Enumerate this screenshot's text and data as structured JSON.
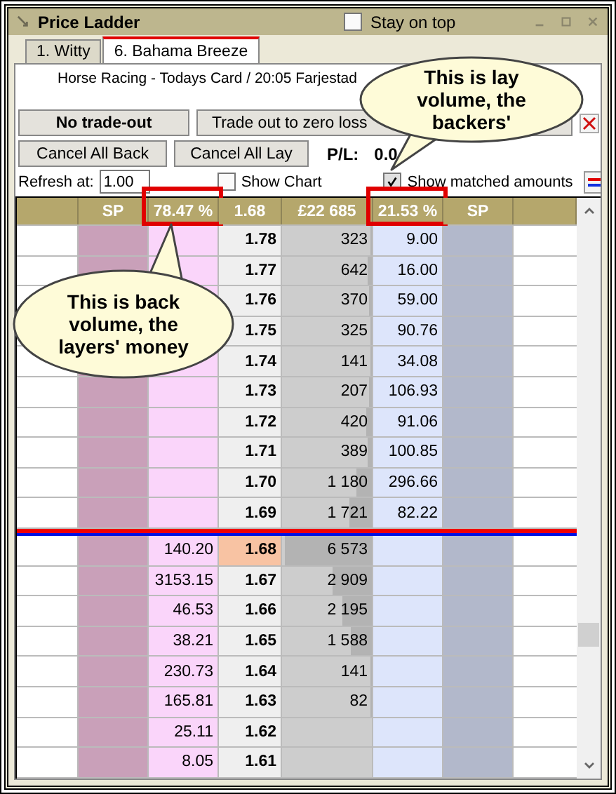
{
  "window": {
    "title": "Price Ladder",
    "stay_on_top": {
      "label": "Stay on top",
      "checked": false
    }
  },
  "tabs": [
    {
      "label": "1. Witty",
      "selected": false
    },
    {
      "label": "6. Bahama Breeze",
      "selected": true
    }
  ],
  "market": "Horse Racing - Todays Card / 20:05 Farjestad",
  "buttons": {
    "no_trade": "No trade-out",
    "trade_out": "Trade out to zero loss",
    "cancel_back": "Cancel All Back",
    "cancel_lay": "Cancel All Lay"
  },
  "pl": {
    "label": "P/L:",
    "value": "0.0"
  },
  "refresh": {
    "label": "Refresh at:",
    "value": "1.00"
  },
  "options": [
    {
      "label": "Show Chart",
      "checked": false
    },
    {
      "label": "Show matched amounts",
      "checked": true
    }
  ],
  "header": [
    {
      "label": "SP",
      "highlighted": false
    },
    {
      "label": "78.47 %",
      "highlighted": true
    },
    {
      "label": "1.68",
      "highlighted": false
    },
    {
      "label": "£22 685",
      "highlighted": false
    },
    {
      "label": "21.53 %",
      "highlighted": true
    },
    {
      "label": "SP",
      "highlighted": false
    }
  ],
  "upper_rows": [
    {
      "price": "1.78",
      "volume": "323",
      "level": 0.02,
      "lay": "9.00"
    },
    {
      "price": "1.77",
      "volume": "642",
      "level": 0.05,
      "lay": "16.00"
    },
    {
      "price": "1.76",
      "volume": "370",
      "level": 0.03,
      "lay": "59.00"
    },
    {
      "price": "1.75",
      "volume": "325",
      "level": 0.02,
      "lay": "90.76"
    },
    {
      "price": "1.74",
      "volume": "141",
      "level": 0.02,
      "lay": "34.08"
    },
    {
      "price": "1.73",
      "volume": "207",
      "level": 0.03,
      "lay": "106.93"
    },
    {
      "price": "1.72",
      "volume": "420",
      "level": 0.06,
      "lay": "91.06"
    },
    {
      "price": "1.71",
      "volume": "389",
      "level": 0.04,
      "lay": "100.85"
    },
    {
      "price": "1.70",
      "volume": "1 180",
      "level": 0.17,
      "lay": "296.66"
    },
    {
      "price": "1.69",
      "volume": "1 721",
      "level": 0.25,
      "lay": "82.22"
    }
  ],
  "lower_rows": [
    {
      "back": "140.20",
      "price": "1.68",
      "current": true,
      "volume": "6 573",
      "level": 0.97
    },
    {
      "back": "3153.15",
      "price": "1.67",
      "current": false,
      "volume": "2 909",
      "level": 0.44
    },
    {
      "back": "46.53",
      "price": "1.66",
      "current": false,
      "volume": "2 195",
      "level": 0.33
    },
    {
      "back": "38.21",
      "price": "1.65",
      "current": false,
      "volume": "1 588",
      "level": 0.24
    },
    {
      "back": "230.73",
      "price": "1.64",
      "current": false,
      "volume": "141",
      "level": 0.02
    },
    {
      "back": "165.81",
      "price": "1.63",
      "current": false,
      "volume": "82",
      "level": 0.01
    },
    {
      "back": "25.11",
      "price": "1.62",
      "current": false
    },
    {
      "back": "8.05",
      "price": "1.61",
      "current": false
    }
  ],
  "callouts": [
    {
      "kind": "lay",
      "text": "This is lay volume, the backers'"
    },
    {
      "kind": "back",
      "text": "This is back volume, the layers' money"
    }
  ]
}
